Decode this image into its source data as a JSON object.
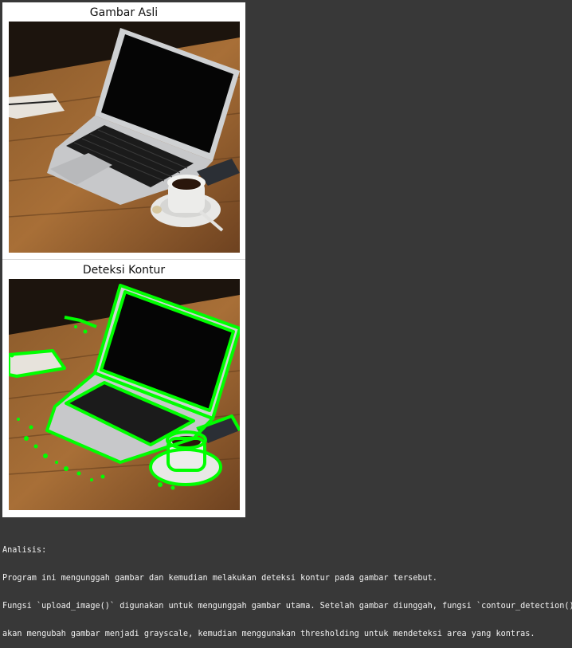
{
  "figure": {
    "subplots": [
      {
        "title": "Gambar Asli",
        "image": "laptop-on-wooden-desk-photo"
      },
      {
        "title": "Deteksi Kontur",
        "image": "laptop-photo-with-green-contours"
      }
    ],
    "contour_color": "#00ff00"
  },
  "output": {
    "lines": [
      "Analisis:",
      "Program ini mengunggah gambar dan kemudian melakukan deteksi kontur pada gambar tersebut.",
      "Fungsi `upload_image()` digunakan untuk mengunggah gambar utama. Setelah gambar diunggah, fungsi `contour_detection()`",
      "akan mengubah gambar menjadi grayscale, kemudian menggunakan thresholding untuk mendeteksi area yang kontras."
    ]
  },
  "colors": {
    "background": "#383838",
    "figure_background": "#ffffff",
    "text": "#f2f2f2"
  }
}
